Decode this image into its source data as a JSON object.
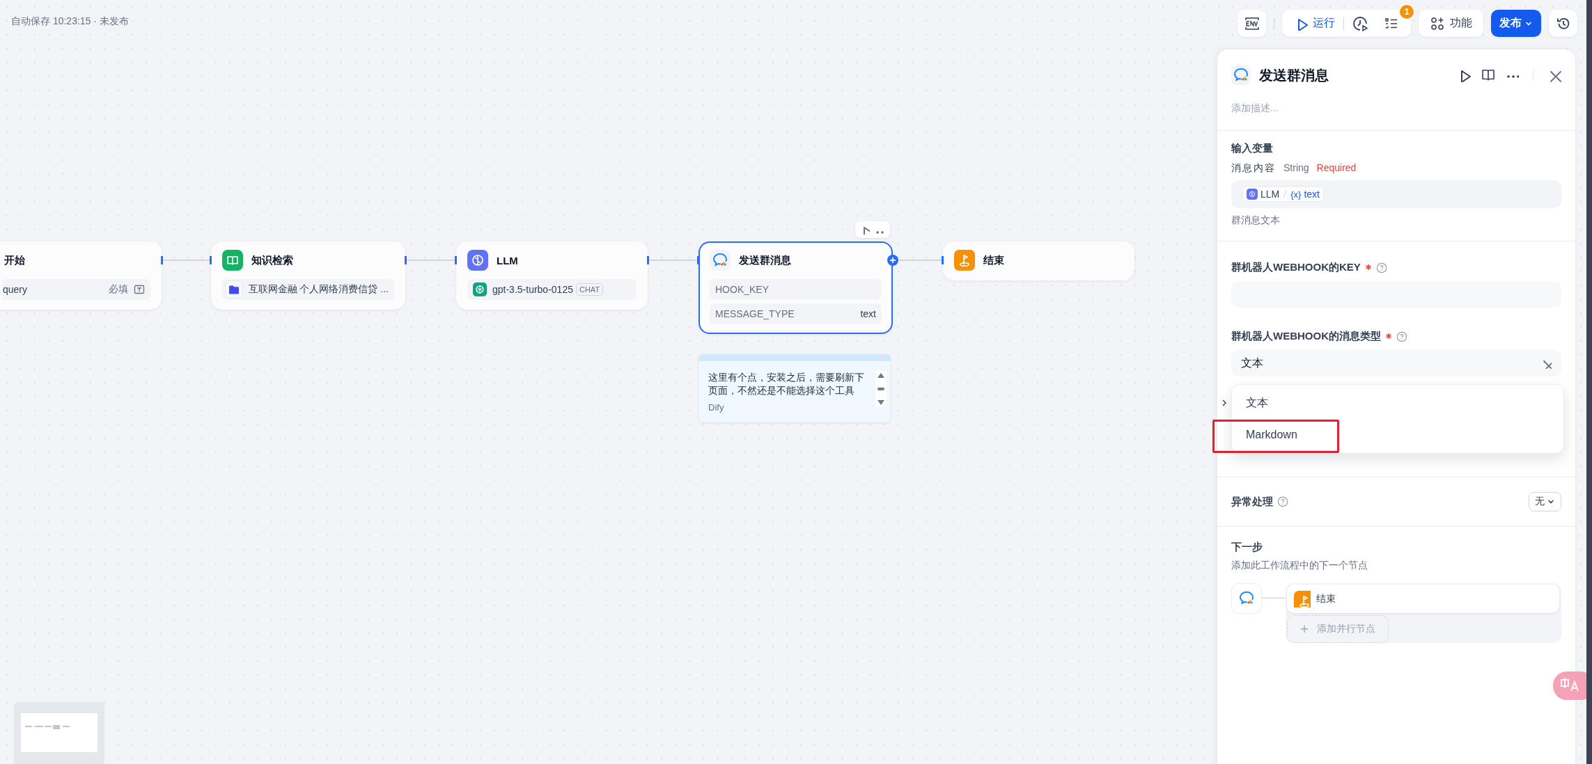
{
  "autosave": "自动保存 10:23:15 · 未发布",
  "toolbar": {
    "run": "运行",
    "checklist_badge": "1",
    "features": "功能",
    "publish": "发布"
  },
  "nodes": [
    {
      "kind": "start",
      "title": "开始",
      "selected": false,
      "rows": [
        {
          "label": "query",
          "value": "必填"
        }
      ]
    },
    {
      "kind": "knowledge",
      "title": "知识检索",
      "selected": false,
      "rows": [
        {
          "label": "互联网金融 个人网络消费信贷 ..."
        }
      ]
    },
    {
      "kind": "llm",
      "title": "LLM",
      "selected": false,
      "rows": [
        {
          "label": "gpt-3.5-turbo-0125",
          "tag": "CHAT"
        }
      ]
    },
    {
      "kind": "tool",
      "title": "发送群消息",
      "selected": true,
      "rows": [
        {
          "label": "HOOK_KEY"
        },
        {
          "label": "MESSAGE_TYPE",
          "value": "text"
        }
      ]
    },
    {
      "kind": "end",
      "title": "结束",
      "selected": false
    }
  ],
  "note": {
    "text": "这里有个点，安装之后，需要刷新下页面，不然还是不能选择这个工具",
    "author": "Dify"
  },
  "panel": {
    "title": "发送群消息",
    "description": "添加描述...",
    "inputs": {
      "heading": "输入变量",
      "var_name": "消息内容",
      "var_type": "String",
      "required": "Required",
      "source_node": "LLM",
      "source_symbol": "{x}",
      "source_var": "text",
      "hint": "群消息文本"
    },
    "params": [
      {
        "kind": "text",
        "label": "群机器人WEBHOOK的KEY",
        "required": true
      },
      {
        "kind": "select",
        "label": "群机器人WEBHOOK的消息类型",
        "required": true,
        "value": "文本"
      }
    ],
    "dropdown": [
      {
        "label": "文本",
        "selected": false,
        "highlighted": false
      },
      {
        "label": "Markdown",
        "selected": false,
        "highlighted": true
      }
    ],
    "error_handling": {
      "label": "异常处理",
      "value": "无"
    },
    "next_step": {
      "heading": "下一步",
      "description": "添加此工作流程中的下一个节点",
      "nodes": [
        {
          "kind": "end",
          "title": "结束"
        }
      ],
      "add_parallel": "添加并行节点"
    }
  }
}
